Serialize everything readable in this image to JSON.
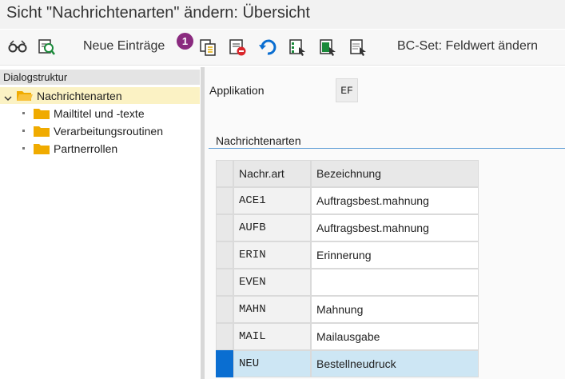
{
  "window": {
    "title": "Sicht \"Nachrichtenarten\" ändern: Übersicht"
  },
  "toolbar": {
    "new_entries_label": "Neue Einträge",
    "badge": "1",
    "bcset_label": "BC-Set: Feldwert ändern",
    "icons": [
      "glasses-icon",
      "find-icon",
      "copy-icon",
      "delete-icon",
      "undo-icon",
      "select-all-icon",
      "select-block-icon",
      "deselect-icon"
    ]
  },
  "tree": {
    "header": "Dialogstruktur",
    "root": "Nachrichtenarten",
    "children": [
      "Mailtitel und -texte",
      "Verarbeitungsroutinen",
      "Partnerrollen"
    ]
  },
  "form": {
    "application_label": "Applikation",
    "application_value": "EF"
  },
  "section": {
    "title": "Nachrichtenarten"
  },
  "table": {
    "headers": [
      "Nachr.art",
      "Bezeichnung"
    ],
    "rows": [
      {
        "code": "ACE1",
        "desc": "Auftragsbest.mahnung"
      },
      {
        "code": "AUFB",
        "desc": "Auftragsbest.mahnung"
      },
      {
        "code": "ERIN",
        "desc": "Erinnerung"
      },
      {
        "code": "EVEN",
        "desc": ""
      },
      {
        "code": "MAHN",
        "desc": "Mahnung"
      },
      {
        "code": "MAIL",
        "desc": "Mailausgabe"
      },
      {
        "code": "NEU",
        "desc": "Bestellneudruck"
      }
    ],
    "selected_row": 6
  },
  "colors": {
    "accent": "#0a6ed1",
    "badge": "#8a2a7f",
    "selected_row": "#cde6f4",
    "tree_selected": "#fbf2c4",
    "folder": "#f0ab00"
  }
}
